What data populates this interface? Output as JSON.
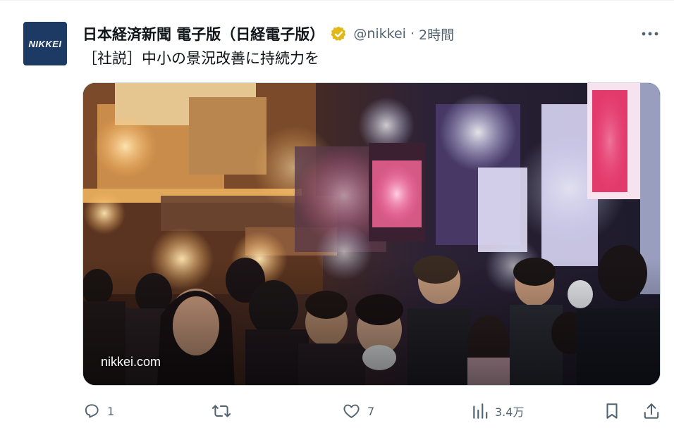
{
  "account": {
    "avatar_text": "NIKKEI",
    "display_name": "日本経済新聞 電子版（日経電子版）",
    "handle": "@nikkei",
    "separator": "·",
    "time": "2時間",
    "verified_color": "#e2b719",
    "avatar_color": "#1d3a64"
  },
  "tweet": {
    "text": "［社説］中小の景況改善に持続力を"
  },
  "media": {
    "domain_label": "nikkei.com"
  },
  "actions": {
    "reply_count": "1",
    "retweet_count": "",
    "like_count": "7",
    "views_count": "3.4万"
  },
  "icons": {
    "more": "more-icon",
    "reply": "reply-icon",
    "retweet": "retweet-icon",
    "like": "like-icon",
    "views": "views-icon",
    "bookmark": "bookmark-icon",
    "share": "share-icon"
  },
  "colors": {
    "text_primary": "#0f1419",
    "text_secondary": "#536471",
    "border": "#cfd9de"
  }
}
